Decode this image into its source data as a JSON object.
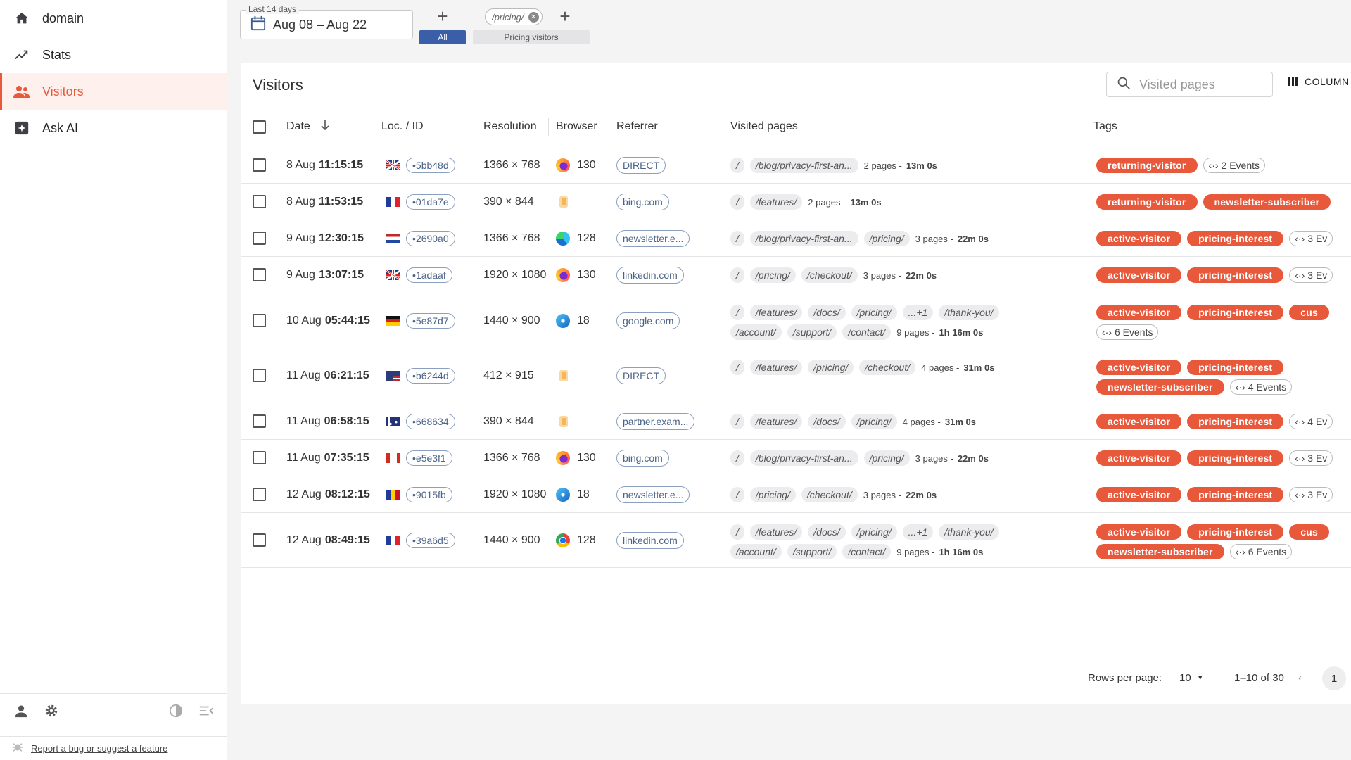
{
  "sidebar": {
    "items": [
      {
        "label": "domain",
        "icon": "home-icon"
      },
      {
        "label": "Stats",
        "icon": "trend-icon"
      },
      {
        "label": "Visitors",
        "icon": "people-icon"
      },
      {
        "label": "Ask AI",
        "icon": "ai-icon"
      }
    ],
    "footer_link": "Report a bug or suggest a feature"
  },
  "topbar": {
    "date_legend": "Last 14 days",
    "date_range": "Aug 08 – Aug 22",
    "segment_all": "All",
    "filter_chip": "/pricing/",
    "segment_label": "Pricing visitors"
  },
  "main": {
    "title": "Visitors",
    "search_placeholder": "Visited pages",
    "columns_label": "COLUMN",
    "headers": {
      "date": "Date",
      "loc": "Loc. / ID",
      "resolution": "Resolution",
      "browser": "Browser",
      "referrer": "Referrer",
      "visited": "Visited pages",
      "tags": "Tags"
    },
    "rows": [
      {
        "day": "8 Aug",
        "time": "11:15:15",
        "flag": "gb",
        "id": "•5bb48d",
        "res": "1366 × 768",
        "browser": "firefox",
        "bver": "130",
        "ref": "DIRECT",
        "pages1": [
          "/",
          "/blog/privacy-first-an..."
        ],
        "pages2": [],
        "count": "2 pages -",
        "dur": "13m 0s",
        "tags1": [
          "returning-visitor"
        ],
        "ev1": "2 Events",
        "tags2": [],
        "ev2": ""
      },
      {
        "day": "8 Aug",
        "time": "11:53:15",
        "flag": "fr",
        "id": "•01da7e",
        "res": "390 × 844",
        "browser": "mobile",
        "bver": "",
        "ref": "bing.com",
        "pages1": [
          "/",
          "/features/"
        ],
        "pages2": [],
        "count": "2 pages -",
        "dur": "13m 0s",
        "tags1": [
          "returning-visitor",
          "newsletter-subscriber"
        ],
        "ev1": "",
        "tags2": [],
        "ev2": ""
      },
      {
        "day": "9 Aug",
        "time": "12:30:15",
        "flag": "nl",
        "id": "•2690a0",
        "res": "1366 × 768",
        "browser": "edge",
        "bver": "128",
        "ref": "newsletter.e...",
        "pages1": [
          "/",
          "/blog/privacy-first-an...",
          "/pricing/"
        ],
        "pages2": [],
        "count": "3 pages -",
        "dur": "22m 0s",
        "tags1": [
          "active-visitor",
          "pricing-interest"
        ],
        "ev1": "3 Ev",
        "tags2": [],
        "ev2": ""
      },
      {
        "day": "9 Aug",
        "time": "13:07:15",
        "flag": "gb",
        "id": "•1adaaf",
        "res": "1920 × 1080",
        "browser": "firefox",
        "bver": "130",
        "ref": "linkedin.com",
        "pages1": [
          "/",
          "/pricing/",
          "/checkout/"
        ],
        "pages2": [],
        "count": "3 pages -",
        "dur": "22m 0s",
        "tags1": [
          "active-visitor",
          "pricing-interest"
        ],
        "ev1": "3 Ev",
        "tags2": [],
        "ev2": ""
      },
      {
        "day": "10 Aug",
        "time": "05:44:15",
        "flag": "de",
        "id": "•5e87d7",
        "res": "1440 × 900",
        "browser": "safari",
        "bver": "18",
        "ref": "google.com",
        "pages1": [
          "/",
          "/features/",
          "/docs/",
          "/pricing/",
          "...+1",
          "/thank-you/"
        ],
        "pages2": [
          "/account/",
          "/support/",
          "/contact/"
        ],
        "count": "9 pages -",
        "dur": "1h 16m 0s",
        "tags1": [
          "active-visitor",
          "pricing-interest",
          "cus"
        ],
        "ev1": "",
        "tags2": [],
        "ev2": "6 Events"
      },
      {
        "day": "11 Aug",
        "time": "06:21:15",
        "flag": "us",
        "id": "•b6244d",
        "res": "412 × 915",
        "browser": "mobile",
        "bver": "",
        "ref": "DIRECT",
        "pages1": [
          "/",
          "/features/",
          "/pricing/",
          "/checkout/"
        ],
        "pages2": [],
        "count": "4 pages -",
        "dur": "31m 0s",
        "tags1": [
          "active-visitor",
          "pricing-interest"
        ],
        "ev1": "",
        "tags2": [
          "newsletter-subscriber"
        ],
        "ev2": "4 Events"
      },
      {
        "day": "11 Aug",
        "time": "06:58:15",
        "flag": "au",
        "id": "•668634",
        "res": "390 × 844",
        "browser": "mobile",
        "bver": "",
        "ref": "partner.exam...",
        "pages1": [
          "/",
          "/features/",
          "/docs/",
          "/pricing/"
        ],
        "pages2": [],
        "count": "4 pages -",
        "dur": "31m 0s",
        "tags1": [
          "active-visitor",
          "pricing-interest"
        ],
        "ev1": "4 Ev",
        "tags2": [],
        "ev2": ""
      },
      {
        "day": "11 Aug",
        "time": "07:35:15",
        "flag": "ca",
        "id": "•e5e3f1",
        "res": "1366 × 768",
        "browser": "firefox",
        "bver": "130",
        "ref": "bing.com",
        "pages1": [
          "/",
          "/blog/privacy-first-an...",
          "/pricing/"
        ],
        "pages2": [],
        "count": "3 pages -",
        "dur": "22m 0s",
        "tags1": [
          "active-visitor",
          "pricing-interest"
        ],
        "ev1": "3 Ev",
        "tags2": [],
        "ev2": ""
      },
      {
        "day": "12 Aug",
        "time": "08:12:15",
        "flag": "ro",
        "id": "•9015fb",
        "res": "1920 × 1080",
        "browser": "safari",
        "bver": "18",
        "ref": "newsletter.e...",
        "pages1": [
          "/",
          "/pricing/",
          "/checkout/"
        ],
        "pages2": [],
        "count": "3 pages -",
        "dur": "22m 0s",
        "tags1": [
          "active-visitor",
          "pricing-interest"
        ],
        "ev1": "3 Ev",
        "tags2": [],
        "ev2": ""
      },
      {
        "day": "12 Aug",
        "time": "08:49:15",
        "flag": "fr",
        "id": "•39a6d5",
        "res": "1440 × 900",
        "browser": "chrome",
        "bver": "128",
        "ref": "linkedin.com",
        "pages1": [
          "/",
          "/features/",
          "/docs/",
          "/pricing/",
          "...+1",
          "/thank-you/"
        ],
        "pages2": [
          "/account/",
          "/support/",
          "/contact/"
        ],
        "count": "9 pages -",
        "dur": "1h 16m 0s",
        "tags1": [
          "active-visitor",
          "pricing-interest",
          "cus"
        ],
        "ev1": "",
        "tags2": [
          "newsletter-subscriber"
        ],
        "ev2": "6 Events"
      }
    ],
    "pagination": {
      "rows_label": "Rows per page:",
      "rows_value": "10",
      "range": "1–10 of 30",
      "page": "1"
    }
  },
  "colors": {
    "accent": "#e8583b",
    "blue": "#3a5ea8"
  }
}
